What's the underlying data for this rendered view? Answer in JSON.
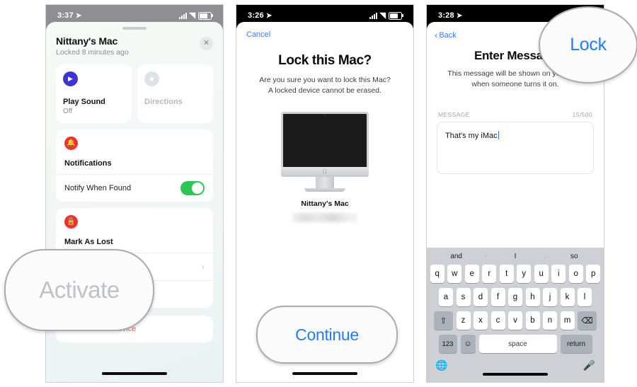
{
  "phone1": {
    "status": {
      "time": "3:37",
      "location_icon": "location-arrow-icon",
      "signal": "signal-bars-icon",
      "wifi": "wifi-icon",
      "battery": "battery-icon"
    },
    "sheet": {
      "title": "Nittany's Mac",
      "subtitle": "Locked 8 minutes ago",
      "close_label": "✕"
    },
    "tiles": [
      {
        "label": "Play Sound",
        "sub": "Off",
        "icon": "play-icon",
        "icon_color": "#3c34d6",
        "disabled": false
      },
      {
        "label": "Directions",
        "sub": "",
        "icon": "directions-icon",
        "icon_color": "#dfe2e4",
        "disabled": true
      }
    ],
    "notifications_card": {
      "icon": "bell-icon",
      "icon_color": "#f5302c",
      "title": "Notifications",
      "row_label": "Notify When Found",
      "toggle_on": true,
      "toggle_color": "#2bc653"
    },
    "mark_lost_card": {
      "icon": "lock-icon",
      "icon_color": "#f5302c",
      "title": "Mark As Lost",
      "row_chevron": "›"
    },
    "remove_label": "Remove This Device"
  },
  "phone2": {
    "status": {
      "time": "3:26",
      "location_icon": "location-arrow-icon"
    },
    "cancel_label": "Cancel",
    "title": "Lock this Mac?",
    "subtitle_line1": "Are you sure you want to lock this Mac?",
    "subtitle_line2": "A locked device cannot be erased.",
    "device_name": "Nittany's Mac",
    "device_icon": "imac-icon",
    "apple_logo": "",
    "legal_text": "For y                                                        be"
  },
  "phone3": {
    "status": {
      "time": "3:28",
      "location_icon": "location-arrow-icon"
    },
    "back_label": "Back",
    "title": "Enter Message",
    "subtitle_line1": "This message will be shown on your Mac",
    "subtitle_line2": "when someone turns it on.",
    "field_label": "MESSAGE",
    "char_counter": "15/500",
    "message_value": "That's my iMac",
    "keyboard": {
      "predictions": [
        "and",
        "I",
        "so"
      ],
      "row1": [
        "q",
        "w",
        "e",
        "r",
        "t",
        "y",
        "u",
        "i",
        "o",
        "p"
      ],
      "row2": [
        "a",
        "s",
        "d",
        "f",
        "g",
        "h",
        "j",
        "k",
        "l"
      ],
      "row3": [
        "z",
        "x",
        "c",
        "v",
        "b",
        "n",
        "m"
      ],
      "shift_icon": "shift-icon",
      "backspace_icon": "backspace-icon",
      "numbers_label": "123",
      "emoji_icon": "emoji-icon",
      "space_label": "space",
      "return_label": "return",
      "globe_icon": "globe-icon",
      "mic_icon": "microphone-icon"
    }
  },
  "callouts": {
    "activate": "Activate",
    "continue": "Continue",
    "lock": "Lock"
  }
}
